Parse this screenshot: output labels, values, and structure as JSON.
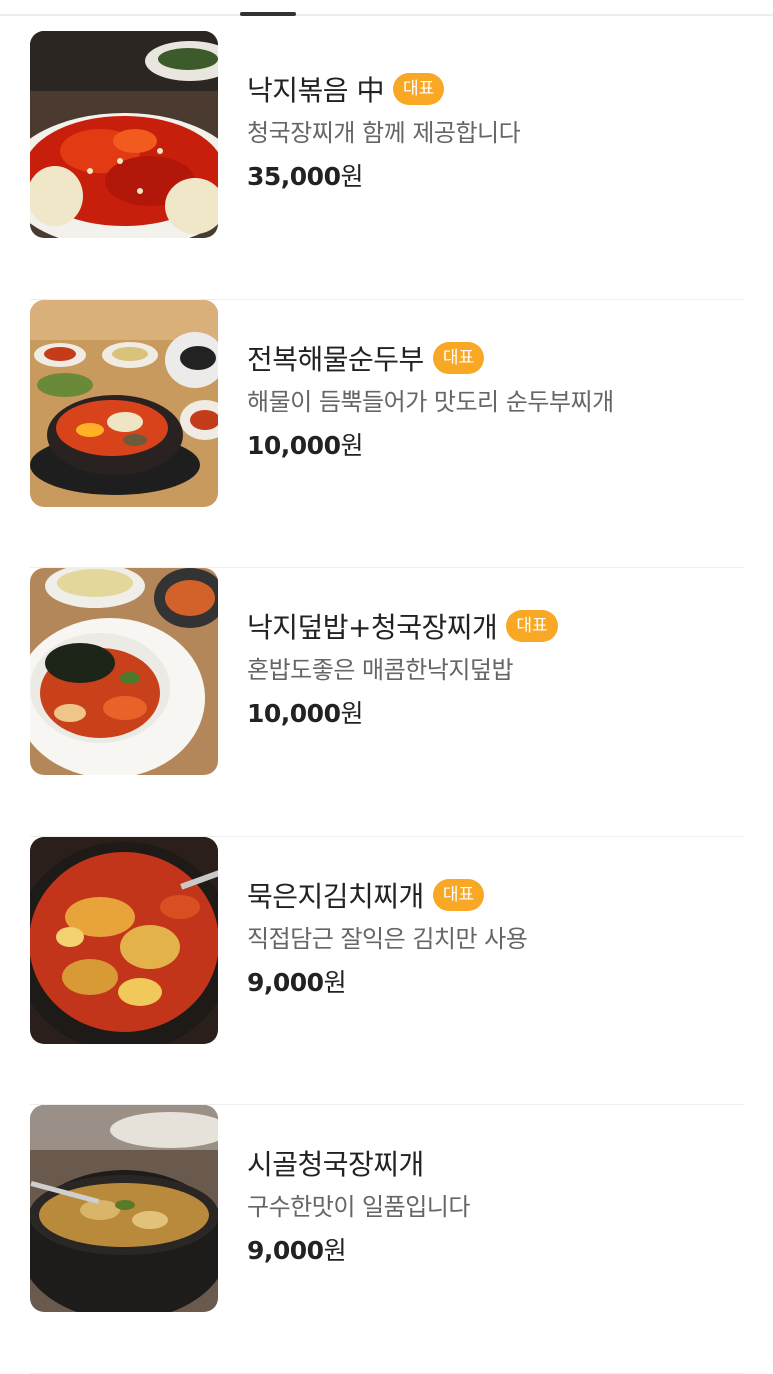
{
  "header": {
    "tab_indicator": "active-tab-indicator"
  },
  "menu": {
    "items": [
      {
        "name": "낙지볶음 中",
        "badge": "대표",
        "description": "청국장찌개 함께 제공합니다",
        "price": "35,000",
        "currency": "원",
        "image": "stir-fried-octopus-photo"
      },
      {
        "name": "전복해물순두부",
        "badge": "대표",
        "description": "해물이 듬뿍들어가 맛도리 순두부찌개",
        "price": "10,000",
        "currency": "원",
        "image": "abalone-seafood-soft-tofu-stew-photo"
      },
      {
        "name": "낙지덮밥+청국장찌개",
        "badge": "대표",
        "description": "혼밥도좋은 매콤한낙지덮밥",
        "price": "10,000",
        "currency": "원",
        "image": "octopus-rice-bowl-photo"
      },
      {
        "name": "묵은지김치찌개",
        "badge": "대표",
        "description": "직접담근 잘익은 김치만 사용",
        "price": "9,000",
        "currency": "원",
        "image": "aged-kimchi-stew-photo"
      },
      {
        "name": "시골청국장찌개",
        "badge": "",
        "description": "구수한맛이 일품입니다",
        "price": "9,000",
        "currency": "원",
        "image": "country-cheonggukjang-stew-photo"
      }
    ]
  },
  "colors": {
    "badge_bg": "#f9a825",
    "badge_text": "#ffffff",
    "title": "#222222",
    "description": "#666666",
    "divider": "#eeeeee"
  }
}
